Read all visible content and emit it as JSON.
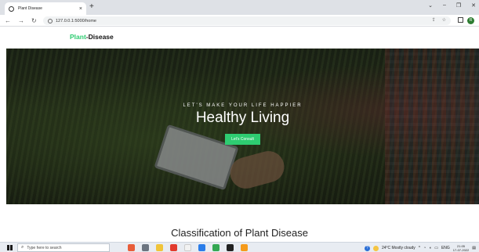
{
  "browser": {
    "tab_title": "Plant Disease",
    "tab_close": "×",
    "new_tab": "+",
    "url": "127.0.0.1:5000/home",
    "window_controls": [
      "⌄",
      "–",
      "❐",
      "✕"
    ]
  },
  "site": {
    "brand_part1": "Plant",
    "brand_part2": "-Disease"
  },
  "hero": {
    "tagline": "LET'S MAKE YOUR LIFE HAPPIER",
    "headline": "Healthy Living",
    "cta_label": "Let's Consult"
  },
  "section": {
    "title": "Classification of Plant Disease"
  },
  "taskbar": {
    "search_placeholder": "Type here to search",
    "weather": "24°C Mostly cloudy",
    "language": "ENG",
    "time": "21:05",
    "date": "17-07-2022"
  },
  "colors": {
    "accent": "#2ecc71"
  }
}
